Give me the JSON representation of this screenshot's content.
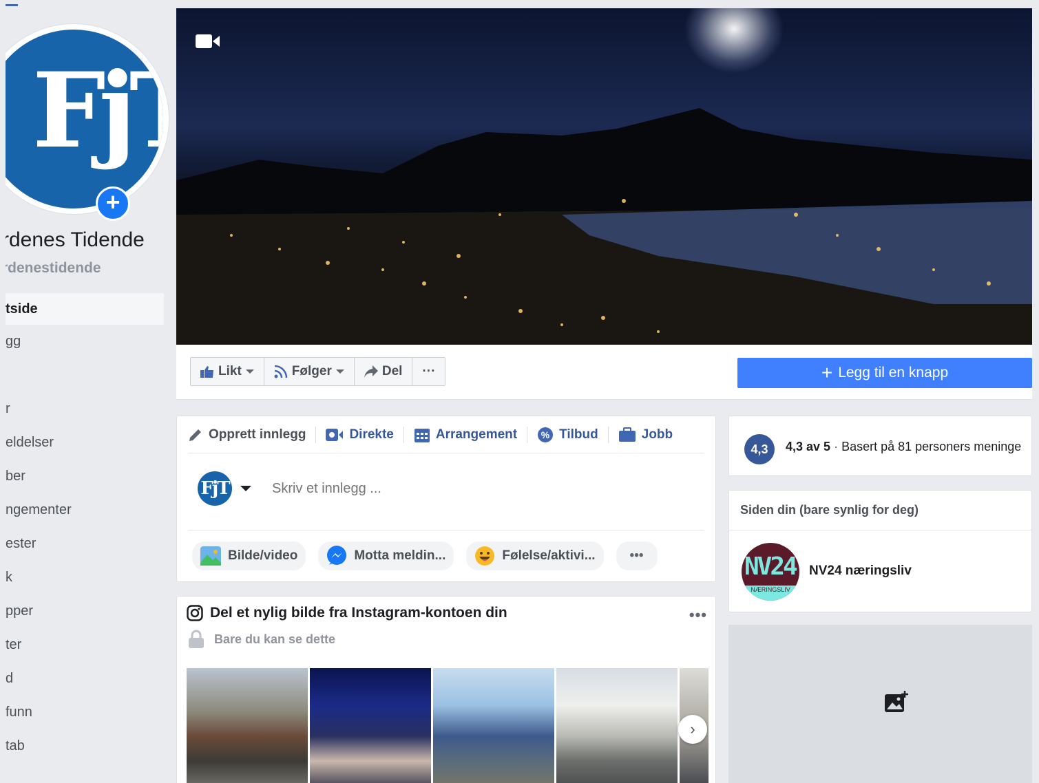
{
  "sidebar": {
    "page_name": "rdenes Tidende",
    "page_handle": "rdenestidende",
    "logo_text": "FjT",
    "items": [
      {
        "label": "tside",
        "active": true
      },
      {
        "label": "gg"
      },
      {
        "label": ""
      },
      {
        "label": "r"
      },
      {
        "label": "eldelser"
      },
      {
        "label": "ber"
      },
      {
        "label": "ngementer"
      },
      {
        "label": "ester"
      },
      {
        "label": "k"
      },
      {
        "label": "pper"
      },
      {
        "label": "ter"
      },
      {
        "label": "d"
      },
      {
        "label": "funn"
      },
      {
        "label": "tab"
      }
    ]
  },
  "actions": {
    "liked": "Likt",
    "following": "Følger",
    "share": "Del",
    "more": "···",
    "add_button": "Legg til en knapp"
  },
  "create_post": {
    "tabs": [
      {
        "label": "Opprett innlegg",
        "icon": "pencil-icon"
      },
      {
        "label": "Direkte",
        "icon": "live-video-icon"
      },
      {
        "label": "Arrangement",
        "icon": "calendar-icon"
      },
      {
        "label": "Tilbud",
        "icon": "offer-icon"
      },
      {
        "label": "Jobb",
        "icon": "briefcase-icon"
      }
    ],
    "placeholder": "Skriv et innlegg ...",
    "logo_text": "FjT",
    "pills": [
      {
        "label": "Bilde/video",
        "icon": "photo-icon"
      },
      {
        "label": "Motta meldin...",
        "icon": "messenger-icon"
      },
      {
        "label": "Følelse/aktivi...",
        "icon": "emoji-icon"
      }
    ],
    "more": "•••"
  },
  "instagram": {
    "title": "Del et nylig bilde fra Instagram-kontoen din",
    "subtitle": "Bare du kan se dette",
    "more": "•••"
  },
  "rating": {
    "badge": "4,3",
    "score": "4,3 av 5",
    "separator": "·",
    "based_on": "Basert på 81 personers meninge"
  },
  "your_page": {
    "heading": "Siden din (bare synlig for deg)",
    "page_name": "NV24 næringsliv",
    "logo_text": "NV24",
    "logo_sub": "NÆRINGSLIV"
  },
  "colors": {
    "brand_blue": "#1764ab",
    "fb_blue": "#4080ff",
    "link_blue": "#365899"
  }
}
